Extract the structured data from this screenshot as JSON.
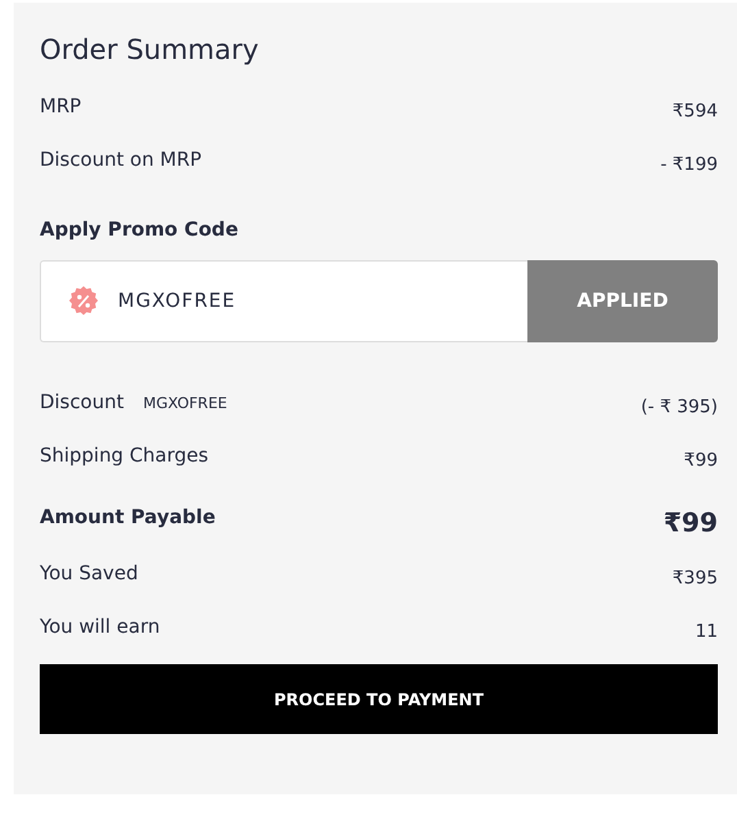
{
  "title": "Order Summary",
  "price_rows": [
    {
      "label": "MRP",
      "value": "₹594"
    },
    {
      "label": "Discount on MRP",
      "value": "- ₹199"
    }
  ],
  "promo": {
    "heading": "Apply Promo Code",
    "value": "MGXOFREE",
    "button": "APPLIED",
    "applied": true
  },
  "summary_rows": [
    {
      "kind": "line",
      "label": "Discount",
      "code": "MGXOFREE",
      "value": "(- ₹ 395)"
    },
    {
      "kind": "line",
      "label": "Shipping Charges",
      "value": "₹99"
    },
    {
      "kind": "total",
      "label": "Amount Payable",
      "value": "₹99"
    },
    {
      "kind": "line",
      "label": "You Saved",
      "value": "₹395"
    },
    {
      "kind": "line",
      "label": "You will earn",
      "value": "11"
    }
  ],
  "button": "PROCEED TO PAYMENT"
}
